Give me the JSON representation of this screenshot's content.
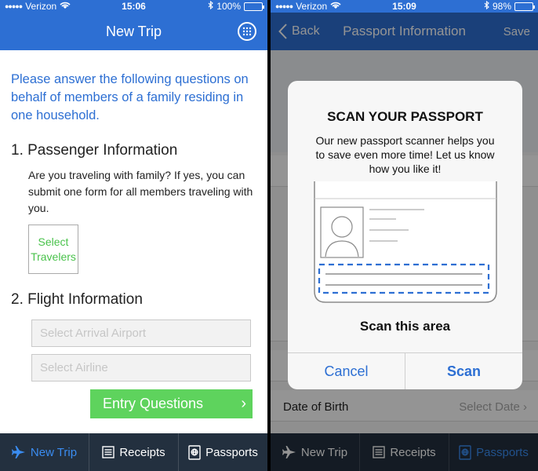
{
  "left": {
    "status": {
      "carrier": "Verizon",
      "time": "15:06",
      "battery": "100%",
      "battery_level": 1.0
    },
    "nav": {
      "title": "New Trip"
    },
    "intro": "Please answer the following questions on behalf of members of a family residing in one household.",
    "section1": {
      "title": "1. Passenger Information",
      "text": "Are you traveling with family? If yes, you can submit one form for all members traveling with you.",
      "select_travelers": "Select Travelers"
    },
    "section2": {
      "title": "2. Flight Information",
      "arrival_placeholder": "Select Arrival Airport",
      "airline_placeholder": "Select Airline"
    },
    "entry_button": "Entry Questions",
    "tabs": [
      {
        "label": "New Trip",
        "icon": "plane-icon",
        "active": true
      },
      {
        "label": "Receipts",
        "icon": "receipt-icon",
        "active": false
      },
      {
        "label": "Passports",
        "icon": "passport-icon",
        "active": false
      }
    ]
  },
  "right": {
    "status": {
      "carrier": "Verizon",
      "time": "15:09",
      "battery": "98%",
      "battery_level": 0.98
    },
    "nav": {
      "back": "Back",
      "title": "Passport Information",
      "save": "Save"
    },
    "background": {
      "dob_label": "Date of Birth",
      "dob_value": "Select Date"
    },
    "dialog": {
      "title": "SCAN YOUR PASSPORT",
      "message": "Our new passport scanner helps you to save even more time! Let us know how you like it!",
      "scan_area_label": "Scan this area",
      "cancel": "Cancel",
      "scan": "Scan"
    },
    "tabs": [
      {
        "label": "New Trip",
        "icon": "plane-icon",
        "active": false
      },
      {
        "label": "Receipts",
        "icon": "receipt-icon",
        "active": false
      },
      {
        "label": "Passports",
        "icon": "passport-icon",
        "active": true
      }
    ]
  },
  "colors": {
    "nav_blue": "#2d6fd3",
    "accent_green": "#5ed35d",
    "tabbar": "#23303f",
    "tab_active": "#3a8cf0"
  }
}
